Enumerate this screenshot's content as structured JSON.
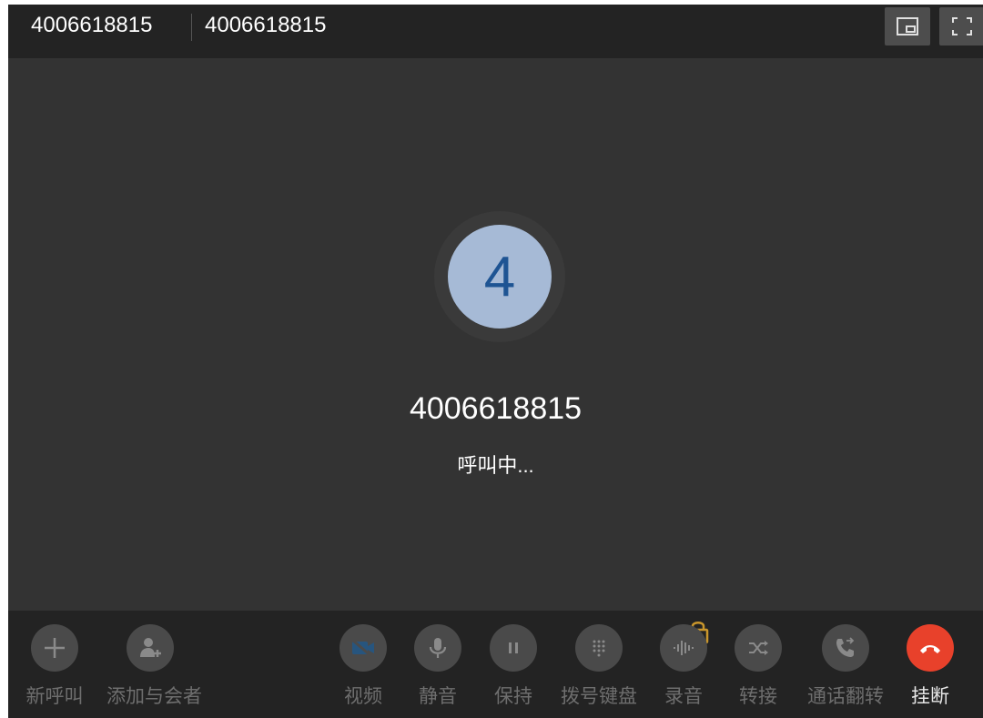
{
  "header": {
    "caller_left": "4006618815",
    "caller_right": "4006618815",
    "buttons": [
      {
        "name": "picture-in-picture",
        "icon": "pip-icon"
      },
      {
        "name": "fullscreen",
        "icon": "fullscreen-icon"
      }
    ]
  },
  "call": {
    "avatar_letter": "4",
    "number": "4006618815",
    "status": "呼叫中..."
  },
  "controls": {
    "new_call": "新呼叫",
    "add_participant": "添加与会者",
    "video": "视频",
    "mute": "静音",
    "hold": "保持",
    "dialpad": "拨号键盘",
    "record": "录音",
    "transfer": "转接",
    "call_flip": "通话翻转",
    "hangup": "挂断"
  },
  "colors": {
    "background": "#333333",
    "bar": "#232323",
    "avatar_bg": "#a6bad6",
    "avatar_text": "#1e5493",
    "hangup": "#e8412b",
    "video_disabled": "#27557e",
    "lock": "#c9962c"
  }
}
